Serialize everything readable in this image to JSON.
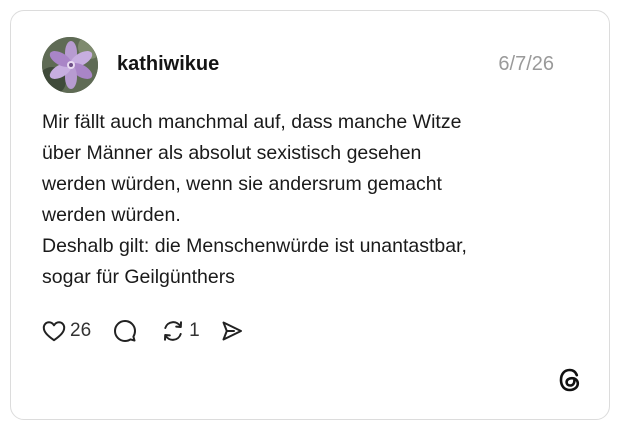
{
  "post": {
    "username": "kathiwikue",
    "date": "6/7/26",
    "body_lines": [
      "Mir fällt auch manchmal auf, dass manche Witze",
      "über Männer als absolut sexistisch gesehen",
      "werden würden, wenn sie andersrum gemacht",
      "werden würden.",
      "Deshalb gilt: die Menschenwürde ist unantastbar,",
      "sogar für Geilgünthers"
    ]
  },
  "actions": {
    "likes": "26",
    "reposts": "1",
    "icons": [
      "heart-icon",
      "comment-icon",
      "repost-icon",
      "share-icon"
    ]
  },
  "branding": {
    "logo_icon": "threads-logo-icon"
  },
  "colors": {
    "text": "#141414",
    "muted": "#9a9a9a",
    "border": "#dcdcdc"
  }
}
